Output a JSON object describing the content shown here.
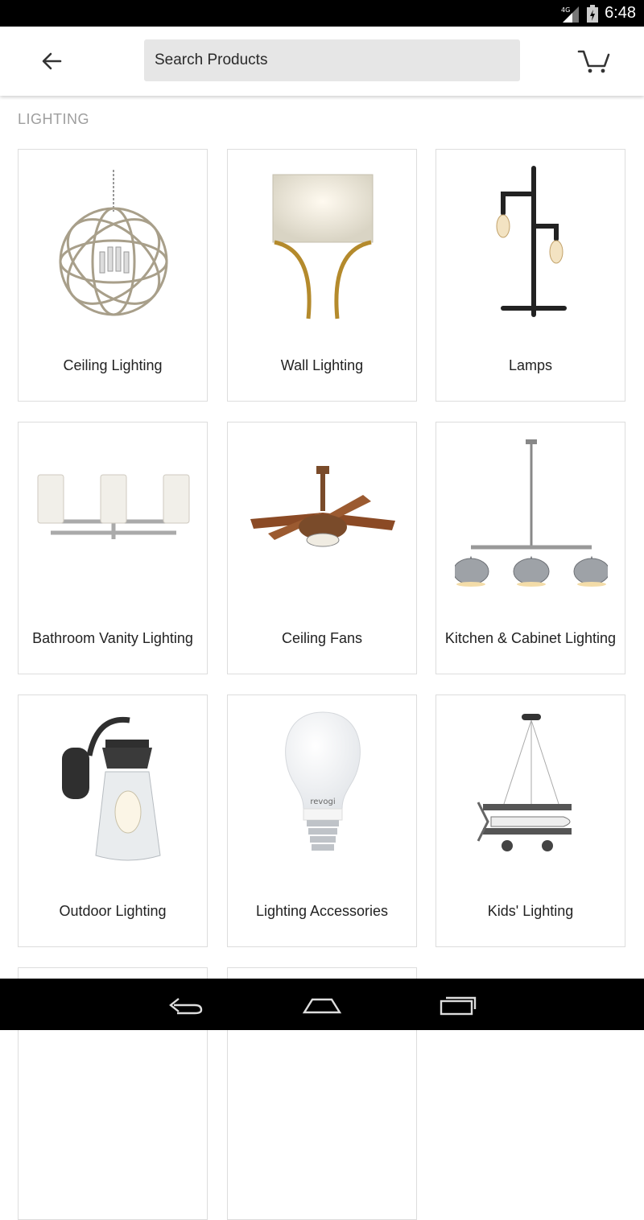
{
  "status_bar": {
    "network": "4G",
    "time": "6:48"
  },
  "header": {
    "back_icon": "arrow-left-icon",
    "search_placeholder": "Search Products",
    "search_value": "",
    "cart_icon": "shopping-cart-icon"
  },
  "section": {
    "title": "LIGHTING"
  },
  "categories": [
    {
      "label": "Ceiling Lighting",
      "icon": "orb-chandelier-image"
    },
    {
      "label": "Wall Lighting",
      "icon": "wall-sconce-image"
    },
    {
      "label": "Lamps",
      "icon": "pipe-lamp-image"
    },
    {
      "label": "Bathroom Vanity Lighting",
      "icon": "vanity-light-image"
    },
    {
      "label": "Ceiling Fans",
      "icon": "ceiling-fan-image"
    },
    {
      "label": "Kitchen & Cabinet Lighting",
      "icon": "pendant-bar-image"
    },
    {
      "label": "Outdoor Lighting",
      "icon": "lantern-image"
    },
    {
      "label": "Lighting Accessories",
      "icon": "light-bulb-image"
    },
    {
      "label": "Kids' Lighting",
      "icon": "airplane-pendant-image"
    }
  ],
  "bulb_brand": "revogi",
  "nav_bar": {
    "back": "nav-back-icon",
    "home": "nav-home-icon",
    "recents": "nav-recents-icon"
  }
}
